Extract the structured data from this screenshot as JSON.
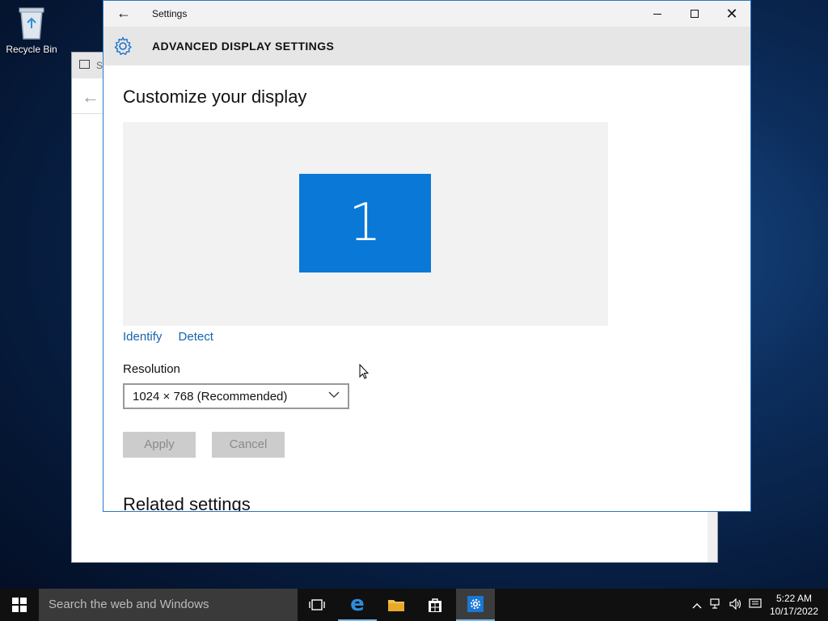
{
  "desktop": {
    "recycle_bin_label": "Recycle Bin"
  },
  "background_window": {
    "title": "S"
  },
  "window": {
    "title": "Settings",
    "header_title": "ADVANCED DISPLAY SETTINGS"
  },
  "content": {
    "page_title": "Customize your display",
    "monitor_number": "1",
    "identify_label": "Identify",
    "detect_label": "Detect",
    "resolution_label": "Resolution",
    "resolution_value": "1024 × 768 (Recommended)",
    "apply_label": "Apply",
    "cancel_label": "Cancel",
    "related_settings": "Related settings"
  },
  "taskbar": {
    "search_placeholder": "Search the web and Windows",
    "time": "5:22 AM",
    "date": "10/17/2022"
  },
  "colors": {
    "accent": "#0a78d7",
    "link": "#1563ad",
    "taskbar": "#101010"
  }
}
